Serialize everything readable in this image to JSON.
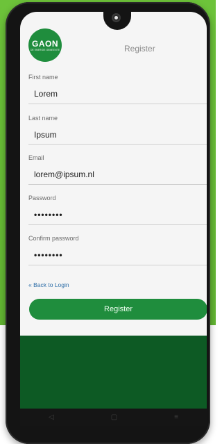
{
  "app": {
    "logo_text": "GAON",
    "logo_subtext": "DE ENERGIE\nGEMEENTE",
    "page_title": "Register"
  },
  "form": {
    "first_name": {
      "label": "First name",
      "value": "Lorem"
    },
    "last_name": {
      "label": "Last name",
      "value": "Ipsum"
    },
    "email": {
      "label": "Email",
      "value": "lorem@ipsum.nl"
    },
    "password": {
      "label": "Password",
      "value": "••••••••"
    },
    "confirm_password": {
      "label": "Confirm password",
      "value": "••••••••"
    }
  },
  "actions": {
    "back_link": "« Back to Login",
    "register_button": "Register"
  },
  "navigation": {
    "back_icon": "◁",
    "home_icon": "▢",
    "menu_icon": "≡"
  },
  "colors": {
    "brand_green": "#1f8d3d",
    "dark_green": "#0d5a24",
    "lime_bg": "#6dc33a"
  }
}
